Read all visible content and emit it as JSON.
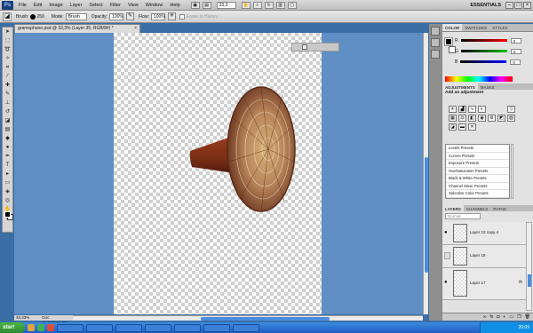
{
  "menubar": {
    "logo": "Ps",
    "items": [
      "File",
      "Edit",
      "Image",
      "Layer",
      "Select",
      "Filter",
      "View",
      "Window",
      "Help"
    ],
    "zoom": "33,3",
    "workspace": "ESSENTIALS",
    "window_buttons": [
      "–",
      "□",
      "×"
    ]
  },
  "optionsbar": {
    "brush_label": "Brush:",
    "brush_size": "250",
    "mode_label": "Mode:",
    "mode_value": "Brush",
    "opacity_label": "Opacity:",
    "opacity_value": "100%",
    "flow_label": "Flow:",
    "flow_value": "100%",
    "erase_history_label": "Erase to History"
  },
  "document": {
    "tab_title": "gramophone.psd @ 33,3% (Layer 35, RGB/8#) *",
    "close": "×"
  },
  "status": {
    "zoom": "33,33%",
    "doc_size": "Doc: 11,3M/103,6M"
  },
  "colors": {
    "canvas_backdrop": "#5f8fc4",
    "horn_body": "#7a2e16",
    "horn_bell": "#b8845a"
  },
  "color_panel": {
    "tabs": [
      "COLOR",
      "SWATCHES",
      "STYLES"
    ],
    "rows": [
      {
        "label": "R",
        "value": "0",
        "bar": "#ff0000"
      },
      {
        "label": "G",
        "value": "0",
        "bar": "#00a000"
      },
      {
        "label": "B",
        "value": "0",
        "bar": "#0000ff"
      }
    ]
  },
  "adjustments": {
    "tabs": [
      "ADJUSTMENTS",
      "MASKS"
    ],
    "title": "Add an adjustment",
    "presets": [
      "Levels Presets",
      "Curves Presets",
      "Exposure Presets",
      "Hue/Saturation Presets",
      "Black & White Presets",
      "Channel Mixer Presets",
      "Selective Color Presets"
    ]
  },
  "layers": {
    "tabs": [
      "LAYERS",
      "CHANNELS",
      "PATHS"
    ],
    "blend_mode": "Normal",
    "items": [
      {
        "name": "Layer 12 copy 4",
        "visible": true,
        "fx": false
      },
      {
        "name": "Layer 18",
        "visible": false,
        "fx": false
      },
      {
        "name": "Layer 17",
        "visible": true,
        "fx": true
      }
    ],
    "footer_icons": [
      "link-icon",
      "fx-icon",
      "mask-icon",
      "adjustment-icon",
      "folder-icon",
      "new-layer-icon",
      "trash-icon"
    ]
  },
  "taskbar": {
    "start": "start",
    "clock": "20:09"
  }
}
